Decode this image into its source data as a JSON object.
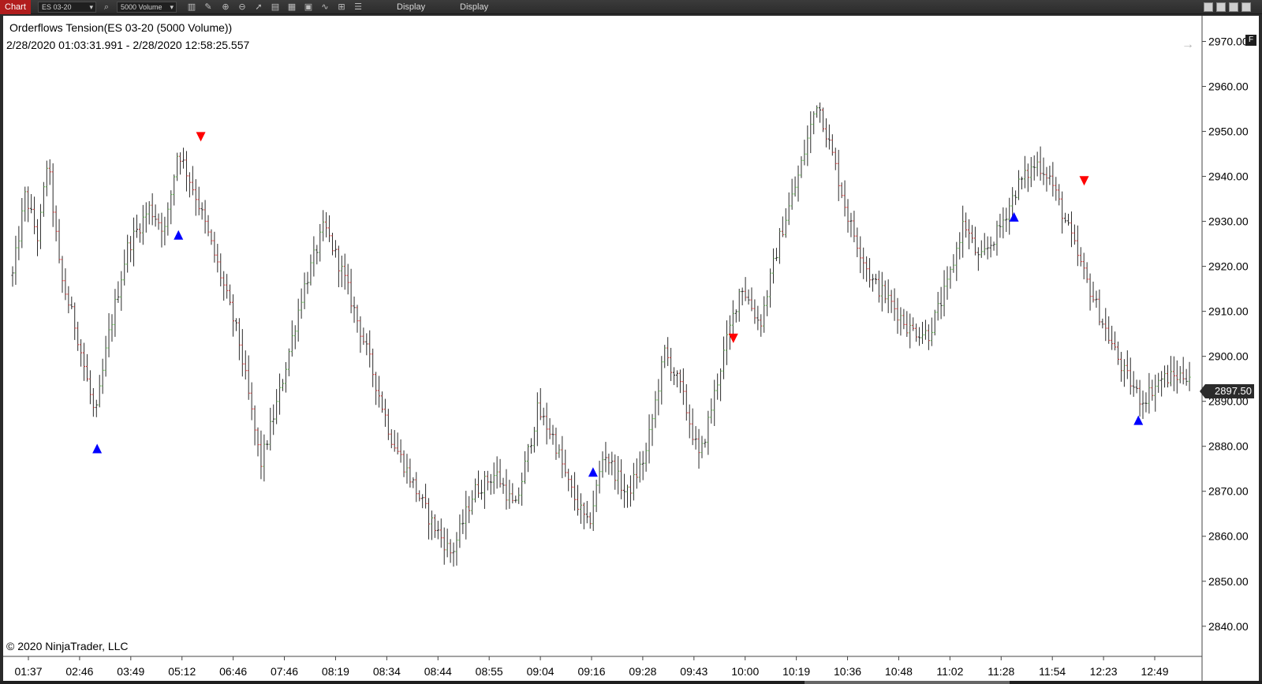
{
  "toolbar": {
    "chart_tab": "Chart",
    "instrument": "ES 03-20",
    "bar_type": "5000 Volume",
    "display_1": "Display",
    "display_2": "Display"
  },
  "chart": {
    "title": "Orderflows Tension(ES 03-20 (5000 Volume))",
    "range": "2/28/2020 01:03:31.991 - 2/28/2020 12:58:25.557",
    "copyright": "© 2020 NinjaTrader, LLC",
    "current_price": "2897.50",
    "f_badge": "F"
  },
  "chart_data": {
    "type": "ohlc",
    "ylim": [
      2834,
      2975
    ],
    "y_ticks": [
      2970,
      2960,
      2950,
      2940,
      2930,
      2920,
      2910,
      2900,
      2890,
      2880,
      2870,
      2860,
      2850,
      2840
    ],
    "y_tick_labels": [
      "2970.00",
      "2960.00",
      "2950.00",
      "2940.00",
      "2930.00",
      "2920.00",
      "2910.00",
      "2900.00",
      "2890.00",
      "2880.00",
      "2870.00",
      "2860.00",
      "2850.00",
      "2840.00"
    ],
    "x_labels": [
      "01:37",
      "02:46",
      "03:49",
      "05:12",
      "06:46",
      "07:46",
      "08:19",
      "08:34",
      "08:44",
      "08:55",
      "09:04",
      "09:16",
      "09:28",
      "09:43",
      "10:00",
      "10:19",
      "10:36",
      "10:48",
      "11:02",
      "11:28",
      "11:54",
      "12:23",
      "12:49"
    ],
    "bar_count": 380,
    "path_anchors": [
      [
        0,
        2918
      ],
      [
        8,
        2936
      ],
      [
        16,
        2926
      ],
      [
        22,
        2944
      ],
      [
        30,
        2918
      ],
      [
        40,
        2906
      ],
      [
        52,
        2886
      ],
      [
        60,
        2904
      ],
      [
        72,
        2924
      ],
      [
        86,
        2933
      ],
      [
        96,
        2928
      ],
      [
        104,
        2946
      ],
      [
        116,
        2935
      ],
      [
        130,
        2919
      ],
      [
        142,
        2904
      ],
      [
        156,
        2876
      ],
      [
        168,
        2892
      ],
      [
        182,
        2914
      ],
      [
        196,
        2929
      ],
      [
        208,
        2918
      ],
      [
        222,
        2902
      ],
      [
        238,
        2882
      ],
      [
        250,
        2873
      ],
      [
        262,
        2864
      ],
      [
        276,
        2856
      ],
      [
        290,
        2870
      ],
      [
        304,
        2874
      ],
      [
        316,
        2866
      ],
      [
        330,
        2888
      ],
      [
        340,
        2882
      ],
      [
        350,
        2871
      ],
      [
        362,
        2862
      ],
      [
        372,
        2879
      ],
      [
        386,
        2869
      ],
      [
        398,
        2878
      ],
      [
        410,
        2901
      ],
      [
        420,
        2893
      ],
      [
        432,
        2877
      ],
      [
        446,
        2899
      ],
      [
        458,
        2916
      ],
      [
        470,
        2907
      ],
      [
        482,
        2926
      ],
      [
        494,
        2940
      ],
      [
        506,
        2957
      ],
      [
        516,
        2944
      ],
      [
        526,
        2930
      ],
      [
        540,
        2917
      ],
      [
        552,
        2912
      ],
      [
        564,
        2906
      ],
      [
        576,
        2905
      ],
      [
        588,
        2916
      ],
      [
        598,
        2930
      ],
      [
        608,
        2921
      ],
      [
        620,
        2928
      ],
      [
        632,
        2938
      ],
      [
        644,
        2943
      ],
      [
        652,
        2940
      ],
      [
        662,
        2930
      ],
      [
        674,
        2918
      ],
      [
        686,
        2907
      ],
      [
        698,
        2897
      ],
      [
        710,
        2890
      ],
      [
        722,
        2895
      ],
      [
        740,
        2896
      ]
    ],
    "signals": [
      {
        "type": "up",
        "price": 2879.5,
        "bar": 53
      },
      {
        "type": "up",
        "price": 2927.0,
        "bar": 104
      },
      {
        "type": "down",
        "price": 2948.8,
        "bar": 118
      },
      {
        "type": "up",
        "price": 2874.3,
        "bar": 364
      },
      {
        "type": "down",
        "price": 2904.0,
        "bar": 452
      },
      {
        "type": "up",
        "price": 2931.0,
        "bar": 628
      },
      {
        "type": "down",
        "price": 2939.0,
        "bar": 672
      },
      {
        "type": "up",
        "price": 2885.8,
        "bar": 706
      }
    ],
    "colors": {
      "up_bar": "#5fb34f",
      "down_bar": "#d64040",
      "neutral_bar": "#333333",
      "up_signal": "#0000ff",
      "down_signal": "#ff0000"
    }
  }
}
